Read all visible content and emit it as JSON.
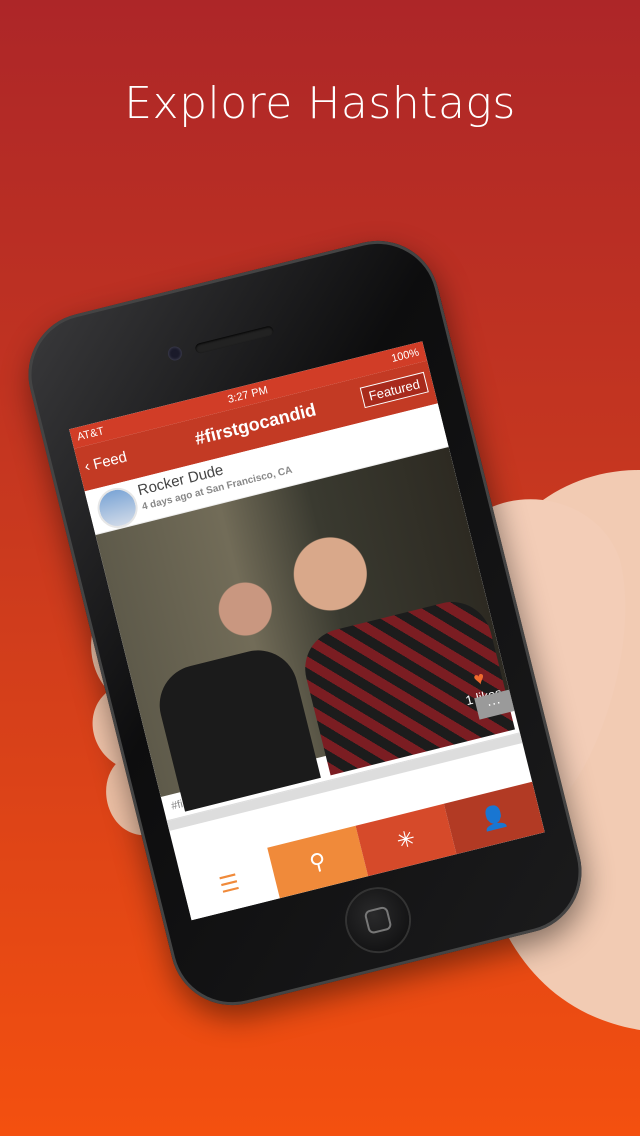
{
  "headline": "Explore Hashtags",
  "status": {
    "carrier": "AT&T",
    "time": "3:27 PM",
    "battery": "100%"
  },
  "nav": {
    "back_label": "Feed",
    "title": "#firstgocandid",
    "featured_label": "Featured"
  },
  "post": {
    "username": "Rocker Dude",
    "meta": "4 days ago at San Francisco, CA",
    "likes": "1 likes",
    "more": "···",
    "hashtag": "#firstGoCandid"
  },
  "icons": {
    "back": "chevron-left-icon",
    "heart": "heart-icon",
    "feed": "list-icon",
    "search": "search-icon",
    "camera": "camera-icon",
    "activity": "spinner-icon",
    "profile": "person-icon"
  },
  "colors": {
    "accent": "#c33a24",
    "orange": "#f08a3a",
    "bg_top": "#ad2628",
    "bg_bottom": "#f4500f"
  }
}
